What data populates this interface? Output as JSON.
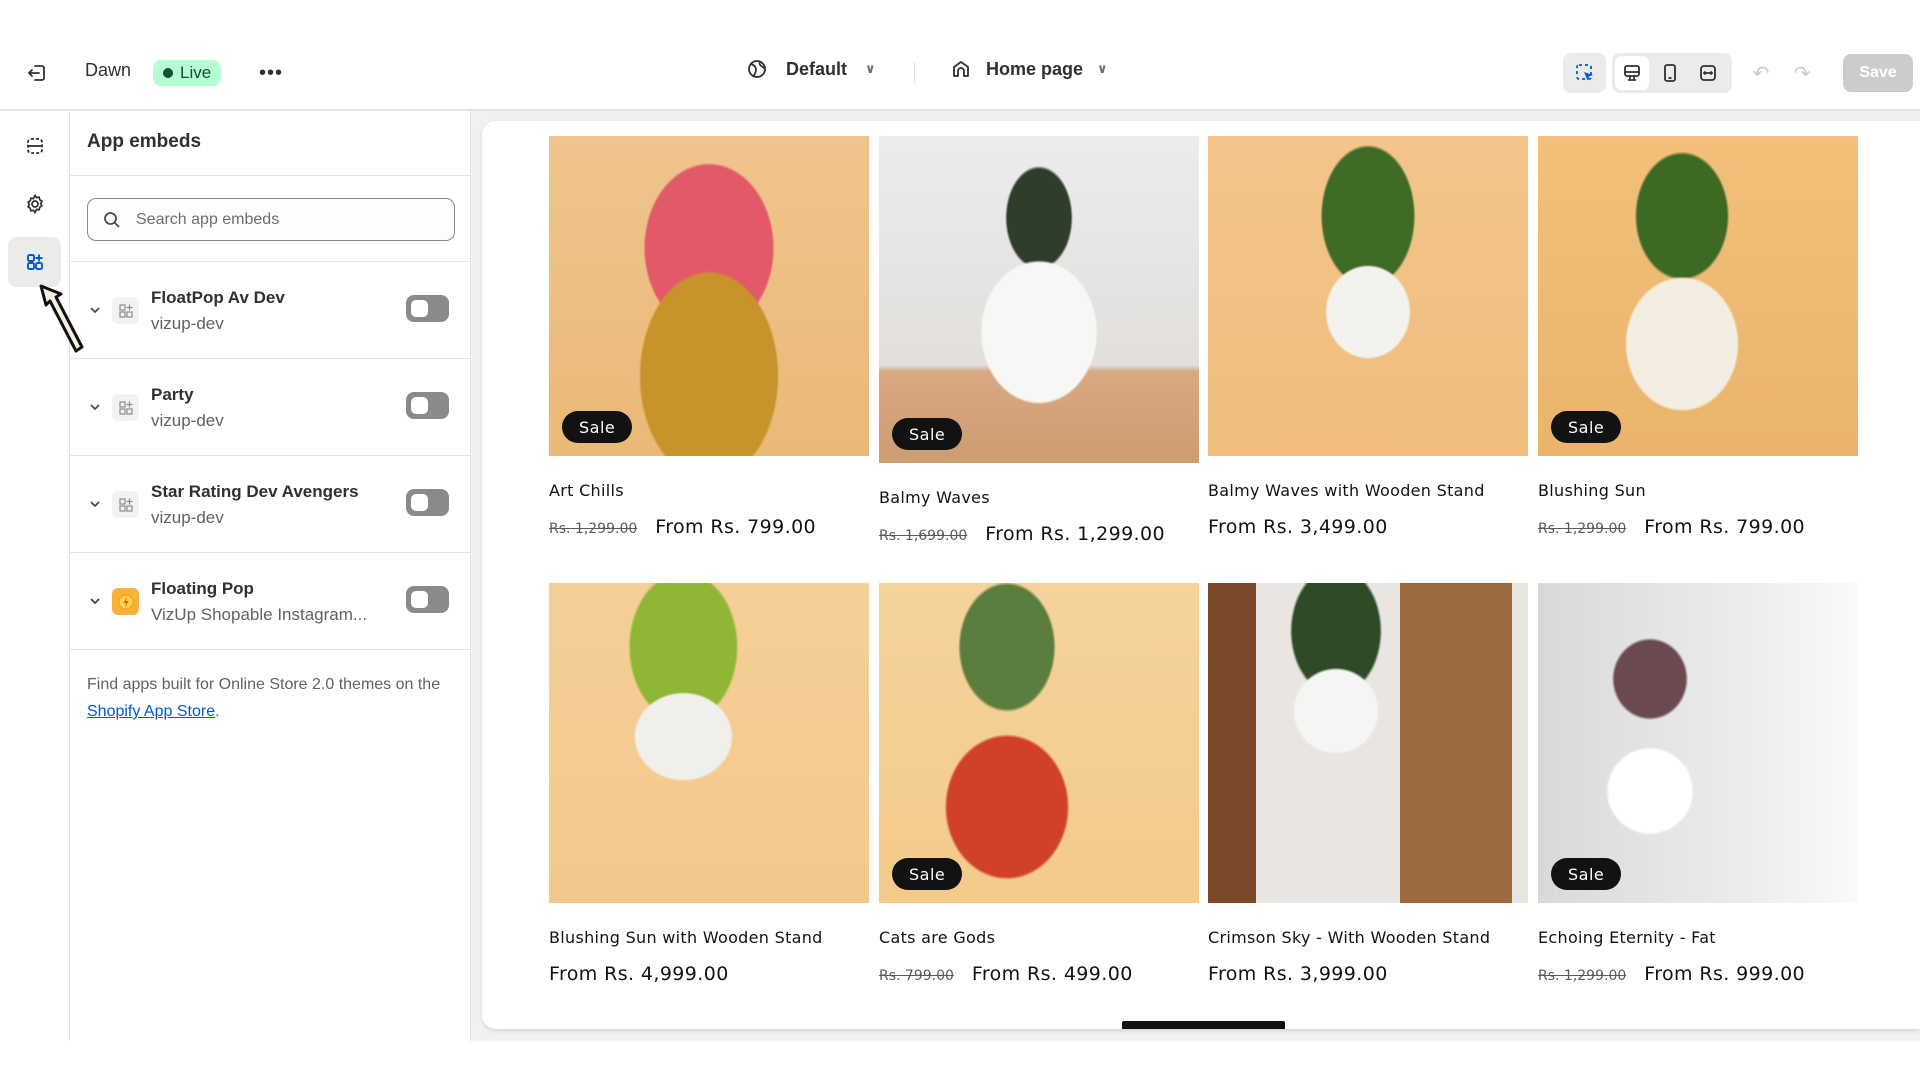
{
  "topbar": {
    "theme_name": "Dawn",
    "live_label": "Live",
    "more_label": "•••",
    "theme_setting": "Default",
    "page_select": "Home page",
    "save_label": "Save",
    "undo_label": "↶",
    "redo_label": "↷",
    "colors": {
      "live_bg": "#b4fed2",
      "live_fg": "#0c5132",
      "accent": "#005bd3"
    }
  },
  "rail": {
    "items": [
      {
        "name": "sections",
        "icon": "sections-icon",
        "active": false
      },
      {
        "name": "theme-settings",
        "icon": "gear-icon",
        "active": false
      },
      {
        "name": "app-embeds",
        "icon": "app-embeds-icon",
        "active": true
      }
    ]
  },
  "panel": {
    "title": "App embeds",
    "search_placeholder": "Search app embeds",
    "search_value": "",
    "embeds": [
      {
        "name": "FloatPop Av Dev",
        "provider": "vizup-dev",
        "enabled": false,
        "icon": "app-grid-icon"
      },
      {
        "name": "Party",
        "provider": "vizup-dev",
        "enabled": false,
        "icon": "app-grid-icon"
      },
      {
        "name": "Star Rating Dev Avengers",
        "provider": "vizup-dev",
        "enabled": false,
        "icon": "app-grid-icon"
      },
      {
        "name": "Floating Pop",
        "provider": "VizUp Shopable Instagram...",
        "enabled": false,
        "icon": "lightning-icon"
      }
    ],
    "footer_text": "Find apps built for Online Store 2.0 themes on the ",
    "footer_link": "Shopify App Store",
    "footer_end": "."
  },
  "preview": {
    "sale_label": "Sale",
    "products": [
      {
        "title": "Art Chills",
        "compare_price": "Rs. 1,299.00",
        "price": "From Rs. 799.00",
        "sale": true
      },
      {
        "title": "Balmy Waves",
        "compare_price": "Rs. 1,699.00",
        "price": "From Rs. 1,299.00",
        "sale": true
      },
      {
        "title": "Balmy Waves with Wooden Stand",
        "compare_price": "",
        "price": "From Rs. 3,499.00",
        "sale": false
      },
      {
        "title": "Blushing Sun",
        "compare_price": "Rs. 1,299.00",
        "price": "From Rs. 799.00",
        "sale": true
      },
      {
        "title": "Blushing Sun with Wooden Stand",
        "compare_price": "",
        "price": "From Rs. 4,999.00",
        "sale": false
      },
      {
        "title": "Cats are Gods",
        "compare_price": "Rs. 799.00",
        "price": "From Rs. 499.00",
        "sale": true
      },
      {
        "title": "Crimson Sky - With Wooden Stand",
        "compare_price": "",
        "price": "From Rs. 3,999.00",
        "sale": false
      },
      {
        "title": "Echoing Eternity - Fat",
        "compare_price": "Rs. 1,299.00",
        "price": "From Rs. 999.00",
        "sale": true
      }
    ]
  }
}
